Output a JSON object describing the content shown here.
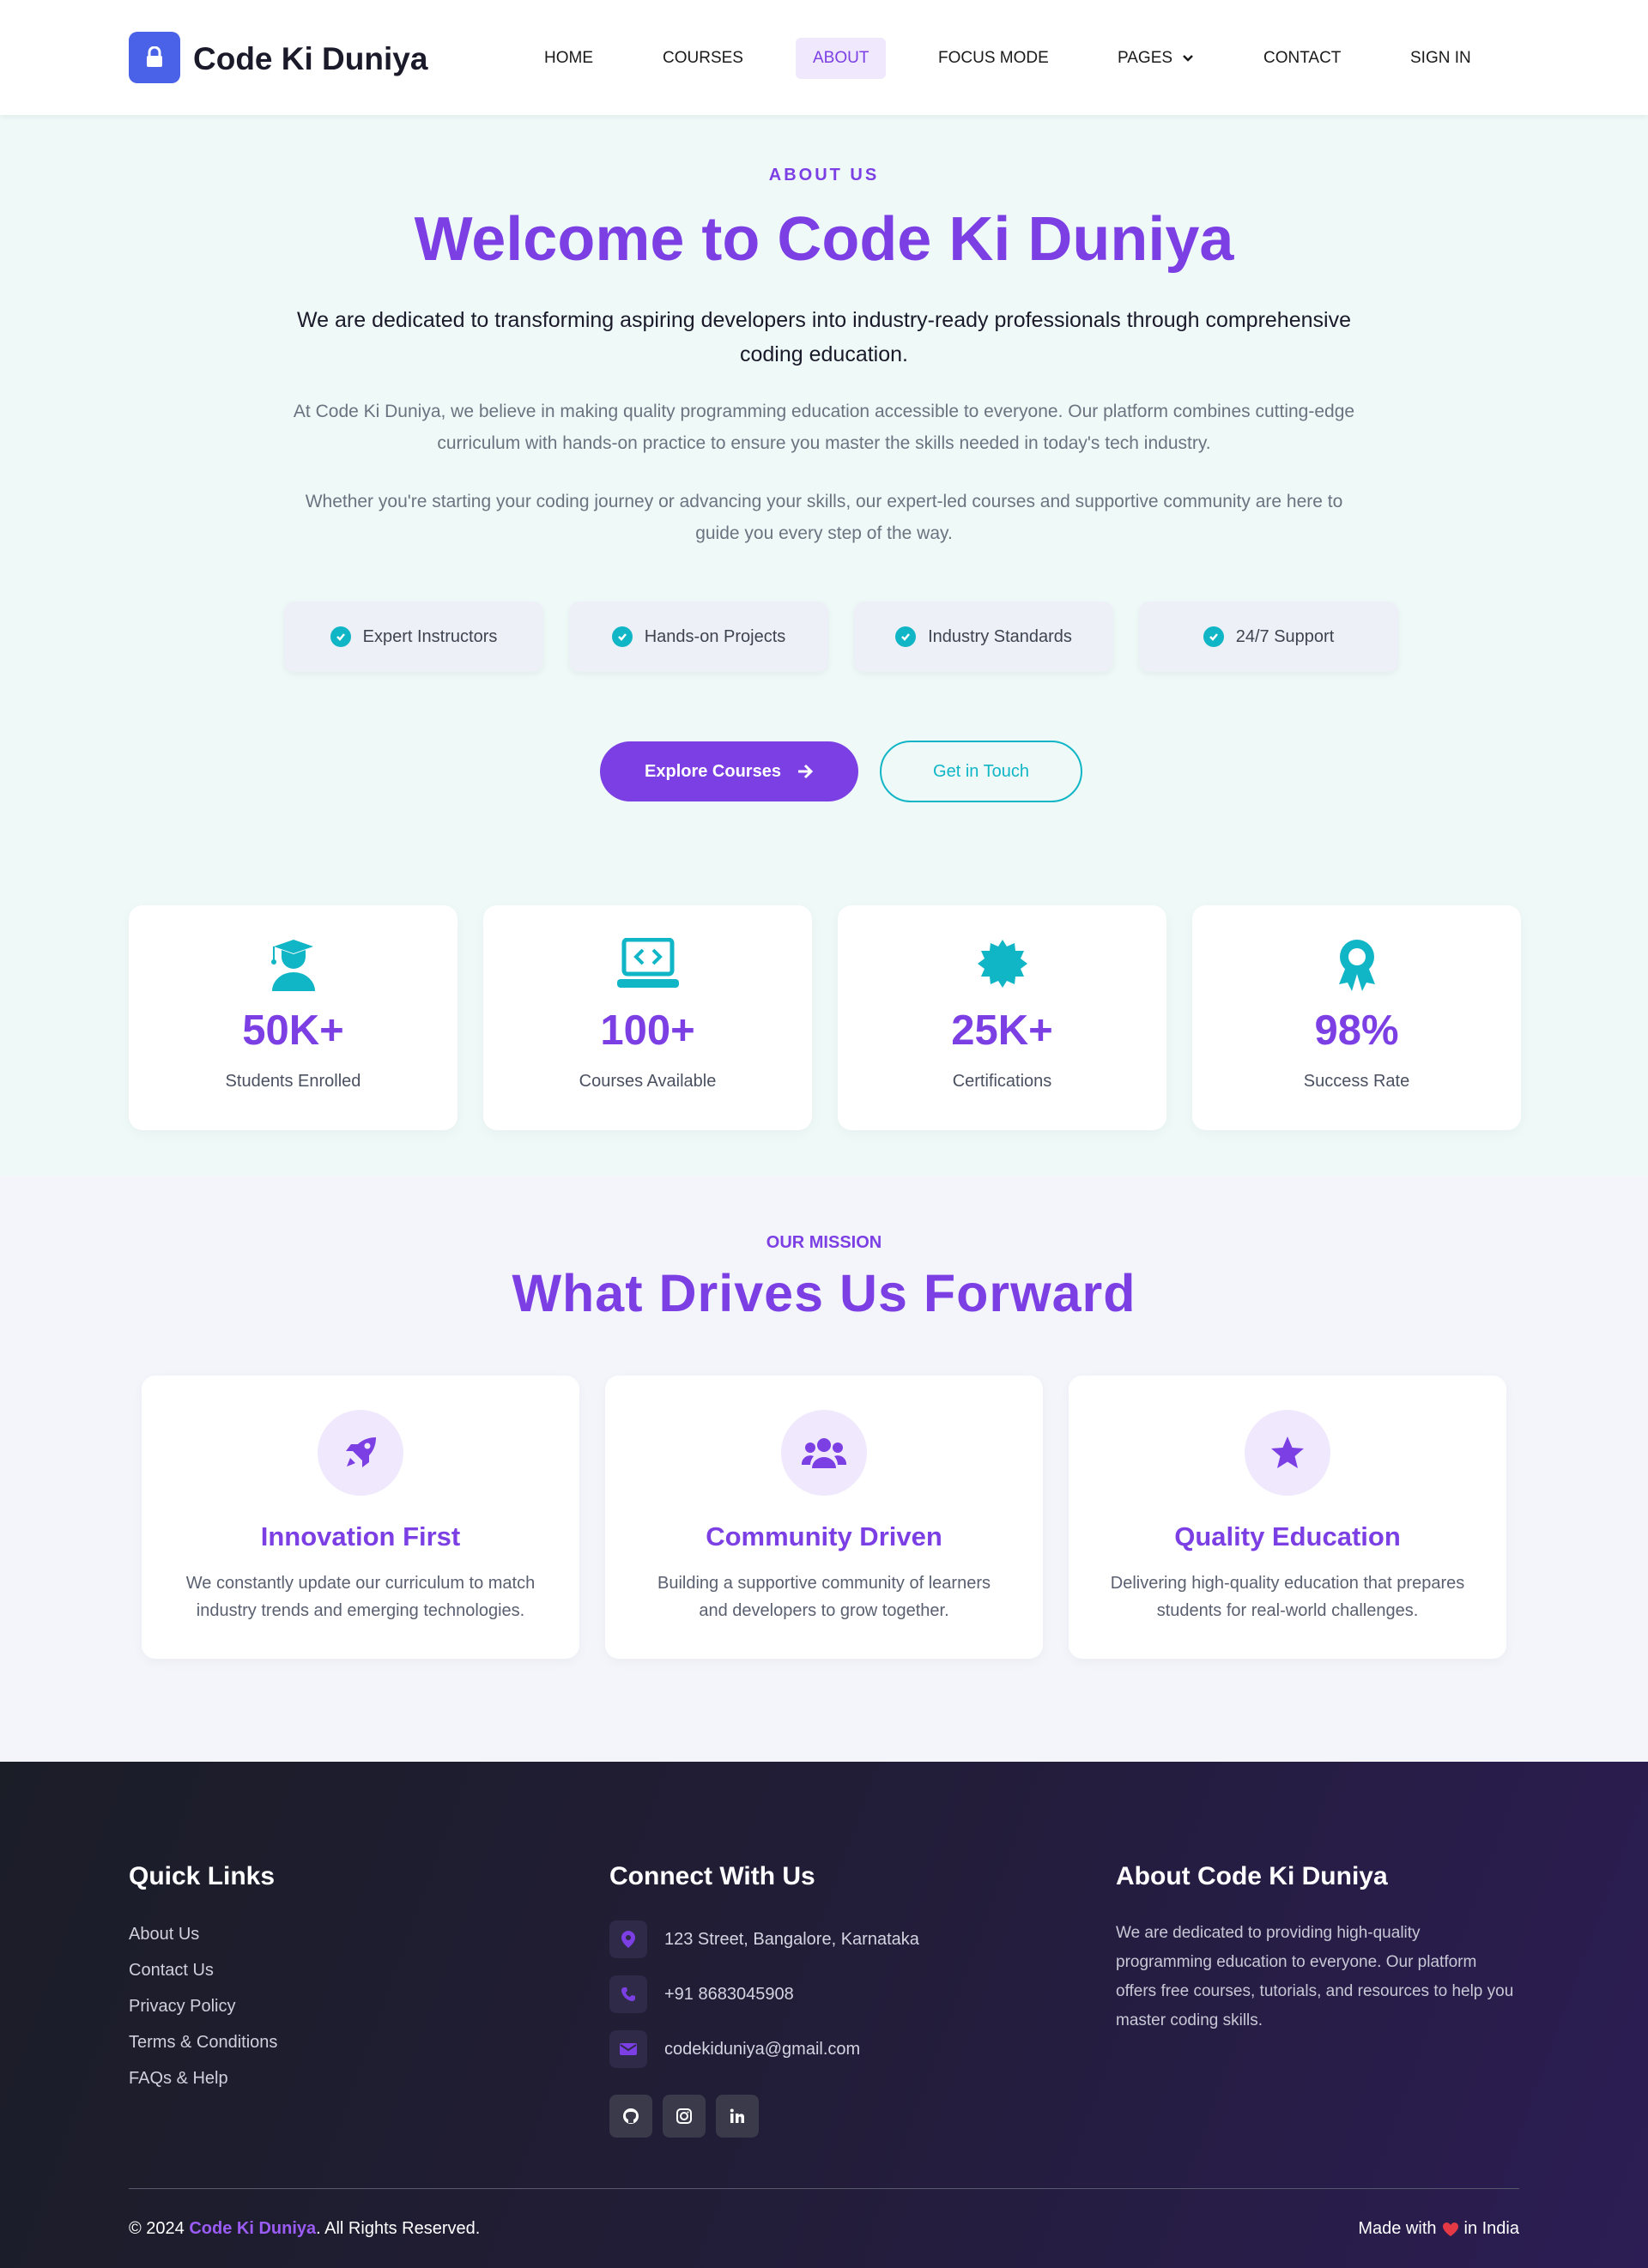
{
  "nav": {
    "brand": "Code Ki Duniya",
    "links": [
      "HOME",
      "COURSES",
      "ABOUT",
      "FOCUS MODE",
      "PAGES",
      "CONTACT",
      "SIGN IN"
    ],
    "active": "ABOUT",
    "icons": {
      "logo": "lock-icon",
      "pages_dropdown": "chevron-down-icon"
    }
  },
  "hero": {
    "eyebrow": "ABOUT US",
    "title": "Welcome to Code Ki Duniya",
    "lead": "We are dedicated to transforming aspiring developers into industry-ready professionals through comprehensive coding education.",
    "paragraphs": [
      "At Code Ki Duniya, we believe in making quality programming education accessible to everyone. Our platform combines cutting-edge curriculum with hands-on practice to ensure you master the skills needed in today's tech industry.",
      "Whether you're starting your coding journey or advancing your skills, our expert-led courses and supportive community are here to guide you every step of the way."
    ],
    "features": [
      "Expert Instructors",
      "Hands-on Projects",
      "Industry Standards",
      "24/7 Support"
    ],
    "primary_button": "Explore Courses",
    "secondary_button": "Get in Touch"
  },
  "stats": [
    {
      "value": "50K+",
      "label": "Students Enrolled",
      "icon": "graduate-icon"
    },
    {
      "value": "100+",
      "label": "Courses Available",
      "icon": "laptop-code-icon"
    },
    {
      "value": "25K+",
      "label": "Certifications",
      "icon": "certificate-icon"
    },
    {
      "value": "98%",
      "label": "Success Rate",
      "icon": "award-icon"
    }
  ],
  "mission": {
    "eyebrow": "OUR MISSION",
    "title": "What Drives Us Forward",
    "cards": [
      {
        "title": "Innovation First",
        "text": "We constantly update our curriculum to match industry trends and emerging technologies.",
        "icon": "rocket-icon"
      },
      {
        "title": "Community Driven",
        "text": "Building a supportive community of learners and developers to grow together.",
        "icon": "users-icon"
      },
      {
        "title": "Quality Education",
        "text": "Delivering high-quality education that prepares students for real-world challenges.",
        "icon": "star-icon"
      }
    ]
  },
  "footer": {
    "quick_links_title": "Quick Links",
    "quick_links": [
      "About Us",
      "Contact Us",
      "Privacy Policy",
      "Terms & Conditions",
      "FAQs & Help"
    ],
    "connect_title": "Connect With Us",
    "address": "123 Street, Bangalore, Karnataka",
    "phone": "+91 8683045908",
    "email": "codekiduniya@gmail.com",
    "socials": [
      "github-icon",
      "instagram-icon",
      "linkedin-icon"
    ],
    "about_title": "About Code Ki Duniya",
    "about_text": "We are dedicated to providing high-quality programming education to everyone. Our platform offers free courses, tutorials, and resources to help you master coding skills.",
    "copyright_prefix": "© 2024 ",
    "copyright_brand": "Code Ki Duniya",
    "copyright_suffix": ". All Rights Reserved.",
    "made_prefix": "Made with",
    "made_suffix": "in India"
  },
  "colors": {
    "accent": "#7b3fe4",
    "teal": "#10b5c6",
    "logo_blue": "#4a62e8",
    "hero_bg": "#eef9f8",
    "heart": "#e53946"
  }
}
